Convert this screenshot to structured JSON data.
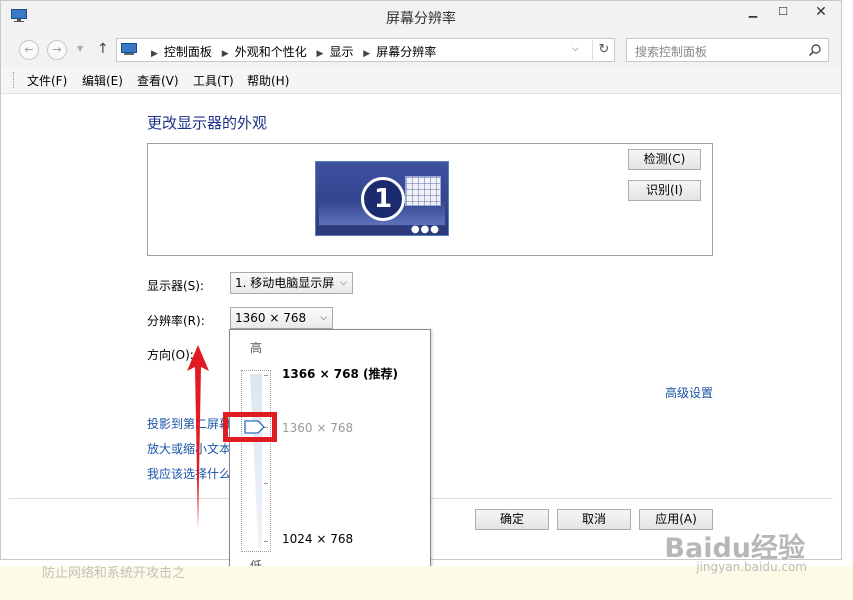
{
  "window": {
    "title": "屏幕分辨率"
  },
  "address": {
    "crumbs": [
      "控制面板",
      "外观和个性化",
      "显示",
      "屏幕分辨率"
    ]
  },
  "search": {
    "placeholder": "搜索控制面板"
  },
  "menu": [
    "文件(F)",
    "编辑(E)",
    "查看(V)",
    "工具(T)",
    "帮助(H)"
  ],
  "main": {
    "heading": "更改显示器的外观",
    "monitor_number": "1",
    "detect_label": "检测(C)",
    "identify_label": "识别(I)",
    "display_label": "显示器(S):",
    "display_value": "1. 移动电脑显示屏",
    "resolution_label": "分辨率(R):",
    "resolution_value": "1360 × 768",
    "orientation_label": "方向(O):",
    "advanced_link": "高级设置",
    "links": [
      "投影到第二屏幕",
      "放大或缩小文本",
      "我应该选择什么"
    ]
  },
  "resolution_popup": {
    "high_label": "高",
    "low_label": "低",
    "options": [
      "1366 × 768 (推荐)",
      "1360 × 768",
      "1024 × 768"
    ],
    "selected": "1360 × 768"
  },
  "buttons": {
    "ok": "确定",
    "cancel": "取消",
    "apply": "应用(A)"
  },
  "footer": {
    "faded_text": "防止网络和系统开攻击之",
    "watermark": "Baidu经验",
    "watermark_url": "jingyan.baidu.com"
  },
  "colors": {
    "heading": "#1e3287",
    "link": "#1a55a8",
    "highlight": "#e11b22",
    "arrow": "#e11b22"
  }
}
